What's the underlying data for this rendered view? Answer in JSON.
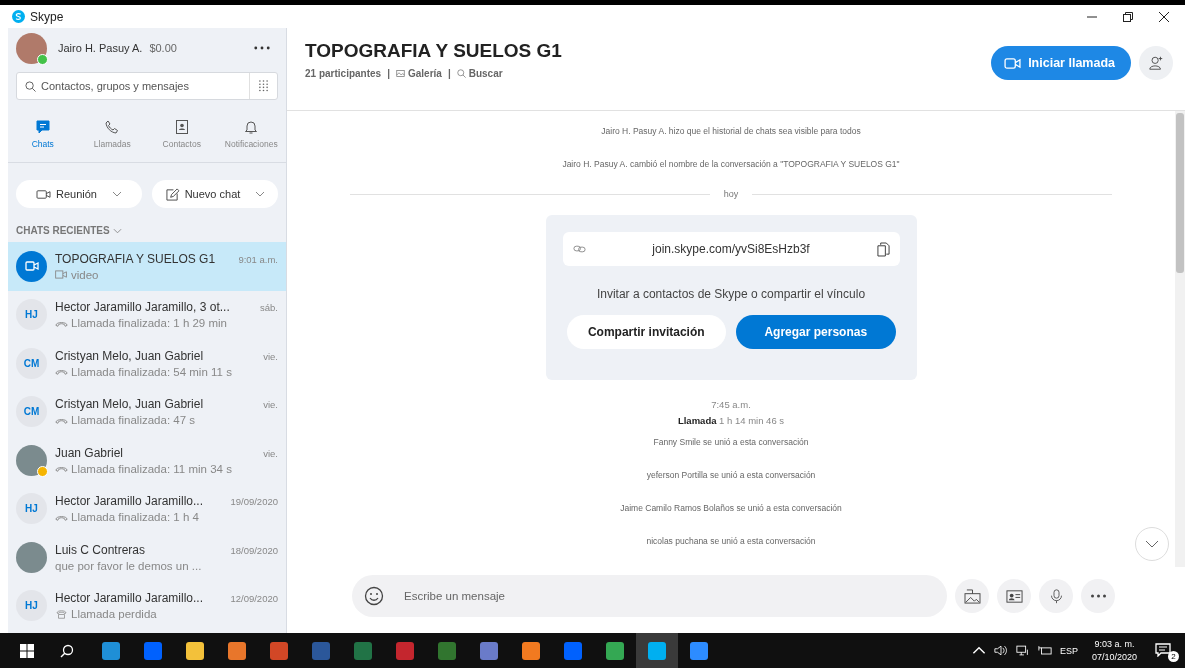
{
  "window": {
    "title": "Skype"
  },
  "profile": {
    "name": "Jairo H. Pasuy A.",
    "credit": "$0.00",
    "presence": {
      "color": "#43c249"
    }
  },
  "search": {
    "placeholder": "Contactos, grupos y mensajes"
  },
  "nav": [
    {
      "label": "Chats",
      "kind": "chats",
      "selected": true
    },
    {
      "label": "Llamadas",
      "kind": "calls",
      "selected": false
    },
    {
      "label": "Contactos",
      "kind": "contacts",
      "selected": false
    },
    {
      "label": "Notificaciones",
      "kind": "notifications",
      "selected": false
    }
  ],
  "actions": [
    {
      "label": "Reunión",
      "kind": "meeting"
    },
    {
      "label": "Nuevo chat",
      "kind": "new-chat"
    }
  ],
  "recent_header": "CHATS RECIENTES",
  "chats": [
    {
      "name": "TOPOGRAFIA Y SUELOS G1",
      "time": "9:01 a.m.",
      "preview": {
        "kind": "video",
        "text": "video"
      },
      "avatar": {
        "kind": "group"
      },
      "selected": true
    },
    {
      "name": "Hector Jaramillo Jaramillo,  3 ot...",
      "time": "sáb.",
      "preview": {
        "kind": "call",
        "text": "Llamada finalizada: 1 h 29 min"
      },
      "avatar": {
        "kind": "initials",
        "text": "HJ"
      },
      "selected": false
    },
    {
      "name": "Cristyan Melo, Juan Gabriel",
      "time": "vie.",
      "preview": {
        "kind": "call",
        "text": "Llamada finalizada: 54 min 11 s"
      },
      "avatar": {
        "kind": "initials",
        "text": "CM"
      },
      "selected": false
    },
    {
      "name": "Cristyan Melo, Juan Gabriel",
      "time": "vie.",
      "preview": {
        "kind": "call",
        "text": "Llamada finalizada: 47 s"
      },
      "avatar": {
        "kind": "initials",
        "text": "CM"
      },
      "selected": false
    },
    {
      "name": "Juan Gabriel",
      "time": "vie.",
      "preview": {
        "kind": "call",
        "text": "Llamada finalizada: 11 min 34 s"
      },
      "avatar": {
        "kind": "photo",
        "presence": {
          "color": "#f5b400"
        }
      },
      "selected": false
    },
    {
      "name": "Hector Jaramillo Jaramillo...",
      "time": "19/09/2020",
      "preview": {
        "kind": "call",
        "text": "Llamada finalizada: 1 h 4"
      },
      "avatar": {
        "kind": "initials",
        "text": "HJ"
      },
      "selected": false
    },
    {
      "name": "Luis C Contreras",
      "time": "18/09/2020",
      "preview": {
        "kind": "text",
        "text": "que por favor le demos un ..."
      },
      "avatar": {
        "kind": "photo"
      },
      "selected": false
    },
    {
      "name": "Hector Jaramillo Jaramillo...",
      "time": "12/09/2020",
      "preview": {
        "kind": "missed",
        "text": "Llamada perdida"
      },
      "avatar": {
        "kind": "initials",
        "text": "HJ"
      },
      "selected": false
    }
  ],
  "conversation": {
    "title": "TOPOGRAFIA Y SUELOS G1",
    "subtitle": [
      {
        "kind": "participants",
        "text": "21 participantes"
      },
      {
        "kind": "separator",
        "text": "|"
      },
      {
        "kind": "gallery",
        "text": "Galería"
      },
      {
        "kind": "separator",
        "text": "|"
      },
      {
        "kind": "search",
        "text": "Buscar"
      }
    ],
    "call_button": "Iniciar llamada"
  },
  "events_before": [
    "Jairo H. Pasuy A. hizo que el historial de chats sea visible para todos",
    "Jairo H. Pasuy A. cambió el nombre de la conversación a \"TOPOGRAFIA Y SUELOS G1\""
  ],
  "day_divider": "hoy",
  "invite": {
    "link": "join.skype.com/yvSi8EsHzb3f",
    "text": "Invitar a contactos de Skype o compartir el vínculo",
    "share_button": "Compartir invitación",
    "add_button": "Agregar personas"
  },
  "call_event": {
    "time": "7:45 a.m.",
    "label": "Llamada",
    "duration": "1 h 14 min 46 s"
  },
  "events_after": [
    "Fanny Smile se unió a esta conversación",
    "yeferson Portilla se unió a esta conversación",
    "Jaime Camilo Ramos Bolaños se unió a esta conversación",
    "nicolas puchana se unió a esta conversación"
  ],
  "composer": {
    "placeholder": "Escribe un mensaje"
  },
  "taskbar": {
    "apps": [
      {
        "color": "#1f8fd6",
        "selected": false
      },
      {
        "color": "#0061fe",
        "selected": false
      },
      {
        "color": "#f3c13a",
        "selected": false
      },
      {
        "color": "#e8762b",
        "selected": false
      },
      {
        "color": "#d24726",
        "selected": false
      },
      {
        "color": "#2b579a",
        "selected": false
      },
      {
        "color": "#217346",
        "selected": false
      },
      {
        "color": "#c4262e",
        "selected": false
      },
      {
        "color": "#31752f",
        "selected": false
      },
      {
        "color": "#6a7bc9",
        "selected": false
      },
      {
        "color": "#f27a20",
        "selected": false
      },
      {
        "color": "#0061fe",
        "selected": false
      },
      {
        "color": "#34a853",
        "selected": false
      },
      {
        "color": "#00aff0",
        "selected": true
      },
      {
        "color": "#2d8cff",
        "selected": false
      }
    ],
    "language": "ESP",
    "time": "9:03 a. m.",
    "date": "07/10/2020",
    "notifications": "2"
  }
}
